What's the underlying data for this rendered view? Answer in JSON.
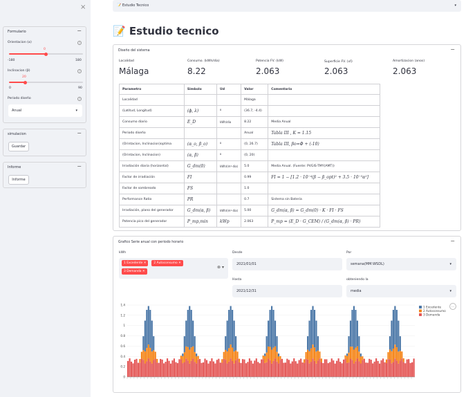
{
  "sidebar": {
    "close": "×",
    "formulario": {
      "title": "Formulario",
      "orientacion": {
        "label": "Orientacion (α)",
        "value": "0",
        "min": "-180",
        "max": "180",
        "fraction": 0.5
      },
      "inclinacion": {
        "label": "Inclinacion (β)",
        "value": "20",
        "min": "0",
        "max": "90",
        "fraction": 0.222
      },
      "periodo": {
        "label": "Periodo diseño",
        "value": "Anual"
      }
    },
    "simulacion": {
      "title": "simulacion",
      "button": "Guardar"
    },
    "informe": {
      "title": "Informe",
      "button": "Informe"
    }
  },
  "topbar": {
    "label": "📝 Estudio Tecnico"
  },
  "page_title": "📝 Estudio tecnico",
  "diseno": {
    "title": "Diseño del sistema",
    "metrics": [
      {
        "label": "Localidad",
        "value": "Málaga"
      },
      {
        "label": "Consumo. (kWh/dia)",
        "value": "8.22"
      },
      {
        "label": "Potencia FV. (kW)",
        "value": "2.063"
      },
      {
        "label": "Superficie FV. (㎡)",
        "value": "2.063"
      },
      {
        "label": "Amortizacion (anos)",
        "value": "2.063"
      }
    ],
    "table": {
      "headers": [
        "Parametro",
        "Simbolo",
        "Ud",
        "Valor",
        "Comentario"
      ],
      "rows": [
        [
          "Localidad",
          "",
          "",
          "Málaga",
          ""
        ],
        [
          "(Latitud, Longitud)",
          "(ϕ, λ)",
          "º",
          "(36.7, -4.4)",
          ""
        ],
        [
          "Consumo diario",
          "E_D",
          "kWh/dia",
          "8.22",
          "Media Anual"
        ],
        [
          "Periodo diseño",
          "",
          "",
          "Anual",
          "Tabla III , K = 1.15"
        ],
        [
          "(Orintacion, Inclinacion)optima",
          "(α_o, β_o)",
          "º",
          "(0, 26.7)",
          "Tabla III, βo=Φ + (-10)"
        ],
        [
          "(Orintacion, Inclinacion)",
          "(α, β)",
          "º",
          "(0, 20)",
          ""
        ],
        [
          "Irradiación diaria (horizontal)",
          "G_dm(0)",
          "kWh/(m²·dia)",
          "5.0",
          "Media Anual. (Fuente: PVGIS-TMY(AMT))"
        ],
        [
          "Factor de irradiación",
          "FI",
          "",
          "0.99",
          "FI = 1 − [1.2 · 10⁻⁴(β − β_opt)² + 3.5 · 10⁻⁵α²]"
        ],
        [
          "Factor de sombreado",
          "FS",
          "",
          "1.0",
          ""
        ],
        [
          "Performance Ratio",
          "PR",
          "",
          "0.7",
          "Sistema sin Bateria"
        ],
        [
          "Irradiación, plano del generador",
          "G_dm(α, β)",
          "kWh/(m²·dia)",
          "5.00",
          "G_dm(α, β) = G_dm(0) · K · FI · FS"
        ],
        [
          "Potencia pico del generador",
          "P_mp,min",
          "kWp",
          "2.063",
          "P_mp = (E_D · G_CEM) / (G_dm(α, β) · PR)"
        ]
      ]
    }
  },
  "grafico": {
    "title": "Grafico Serie anual con periodo horario",
    "kwh_label": "kWh",
    "tags": [
      "1 Excedente",
      "2 Autoconsumo",
      "3 Demanda"
    ],
    "desde_label": "Desde",
    "desde_value": "2021/01/01",
    "hasta_label": "Hasta",
    "hasta_value": "2021/12/31",
    "por_label": "Por",
    "por_value": "semana(MM:WSDL)",
    "obteniendo_label": "obteniendo la",
    "obteniendo_value": "media",
    "more_button": "···"
  },
  "chart_data": {
    "type": "bar",
    "stacked": true,
    "title": "",
    "xlabel": "",
    "ylabel": "",
    "ylim": [
      0,
      1.4
    ],
    "yticks": [
      "0",
      "0.2",
      "0.4",
      "0.6",
      "0.8",
      "1",
      "1.2",
      "1.4"
    ],
    "legend_position": "top-right",
    "colors": {
      "excedente": "#4c78a8",
      "autoconsumo": "#f58518",
      "demanda": "#e45756"
    },
    "pattern_days": 7,
    "hours_per_day": 24,
    "series": [
      {
        "name": "1 Excedente",
        "profile_peak": 1.38,
        "profile_note_free": true
      },
      {
        "name": "2 Autoconsumo",
        "profile_peak": 0.27
      },
      {
        "name": "3 Demanda",
        "profile_base": 0.26,
        "profile_peak": 0.43
      }
    ]
  }
}
